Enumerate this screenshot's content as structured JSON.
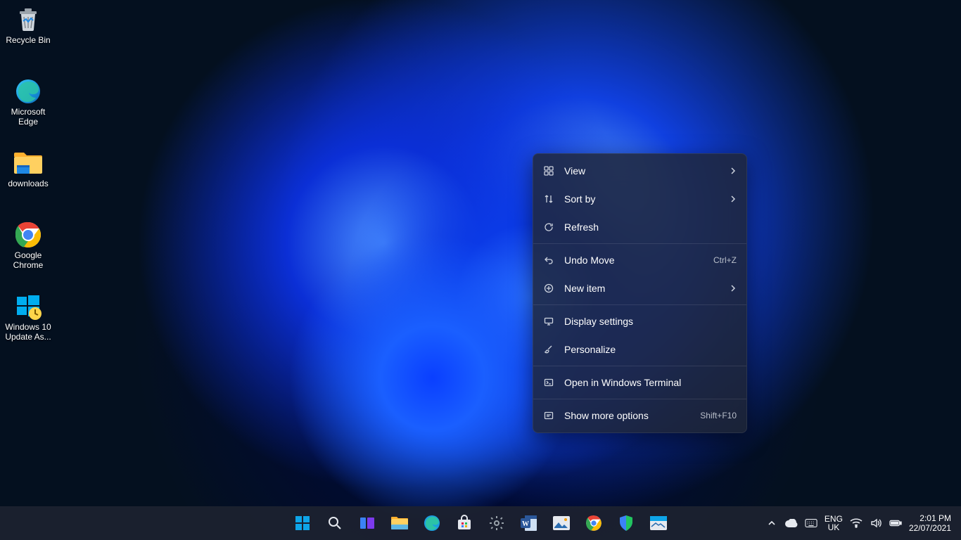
{
  "desktop_icons": [
    {
      "name": "recycle-bin",
      "label": "Recycle Bin"
    },
    {
      "name": "microsoft-edge",
      "label": "Microsoft Edge"
    },
    {
      "name": "downloads-folder",
      "label": "downloads"
    },
    {
      "name": "google-chrome",
      "label": "Google Chrome"
    },
    {
      "name": "windows-update-assistant",
      "label": "Windows 10 Update As..."
    }
  ],
  "context_menu": {
    "groups": [
      [
        {
          "icon": "grid",
          "label": "View",
          "submenu": true
        },
        {
          "icon": "sort",
          "label": "Sort by",
          "submenu": true
        },
        {
          "icon": "refresh",
          "label": "Refresh"
        }
      ],
      [
        {
          "icon": "undo",
          "label": "Undo Move",
          "shortcut": "Ctrl+Z"
        },
        {
          "icon": "plus-circle",
          "label": "New item",
          "submenu": true
        }
      ],
      [
        {
          "icon": "display",
          "label": "Display settings"
        },
        {
          "icon": "brush",
          "label": "Personalize"
        }
      ],
      [
        {
          "icon": "terminal",
          "label": "Open in Windows Terminal"
        }
      ],
      [
        {
          "icon": "more",
          "label": "Show more options",
          "shortcut": "Shift+F10"
        }
      ]
    ]
  },
  "taskbar": {
    "pinned": [
      "start",
      "search",
      "task-view",
      "file-explorer",
      "edge",
      "microsoft-store",
      "settings",
      "word",
      "photos",
      "chrome",
      "security",
      "mail"
    ]
  },
  "systray": {
    "lang_top": "ENG",
    "lang_bottom": "UK",
    "time": "2:01 PM",
    "date": "22/07/2021"
  }
}
